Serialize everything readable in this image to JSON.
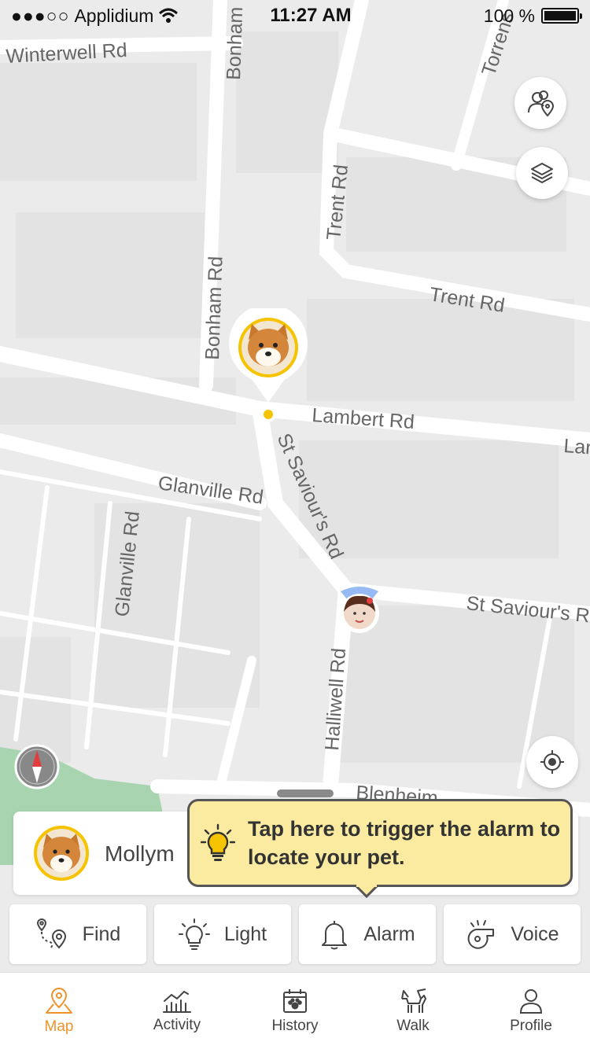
{
  "status_bar": {
    "carrier": "Applidium",
    "time": "11:27 AM",
    "battery": "100 %"
  },
  "map": {
    "streets": [
      "Winterwell Rd",
      "Bonham Rd",
      "Bonham Rd",
      "Trent Rd",
      "Trent Rd",
      "Torrens",
      "Lambert Rd",
      "Lar",
      "Glanville Rd",
      "Glanville Rd",
      "St Saviour's Rd",
      "St Saviour's R",
      "Halliwell Rd",
      "Blenheim"
    ]
  },
  "pet": {
    "name": "Mollym"
  },
  "tooltip": {
    "text": "Tap here to trigger the alarm to locate your pet."
  },
  "actions": [
    {
      "label": "Find",
      "icon": "route-pin-icon"
    },
    {
      "label": "Light",
      "icon": "bulb-icon"
    },
    {
      "label": "Alarm",
      "icon": "bell-icon"
    },
    {
      "label": "Voice",
      "icon": "whistle-icon"
    }
  ],
  "tabs": [
    {
      "label": "Map",
      "icon": "map-pin-icon",
      "active": true
    },
    {
      "label": "Activity",
      "icon": "chart-icon",
      "active": false
    },
    {
      "label": "History",
      "icon": "calendar-paw-icon",
      "active": false
    },
    {
      "label": "Walk",
      "icon": "dog-walk-icon",
      "active": false
    },
    {
      "label": "Profile",
      "icon": "person-icon",
      "active": false
    }
  ],
  "colors": {
    "accent": "#f0932b",
    "pin_yellow": "#f6c300",
    "tooltip_bg": "#fbeba0",
    "park_green": "#a8d5b0"
  }
}
